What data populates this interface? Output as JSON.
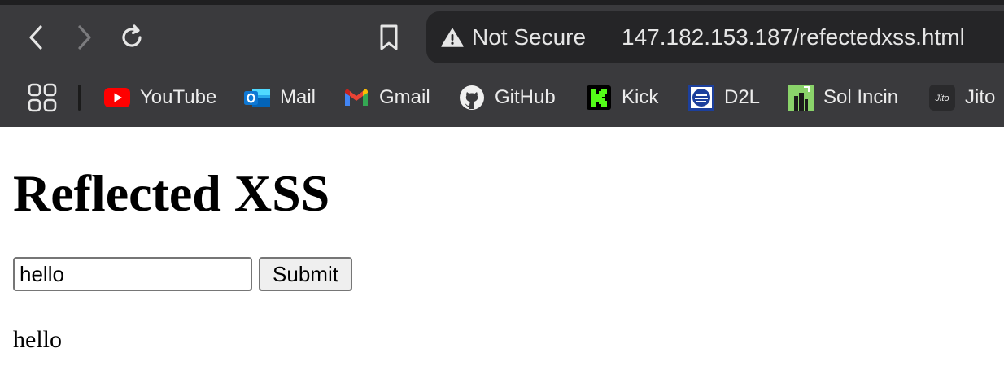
{
  "browser": {
    "address": {
      "security_label": "Not Secure",
      "url": "147.182.153.187/refectedxss.html"
    },
    "bookmarks": [
      {
        "label": "YouTube",
        "icon": "youtube-icon"
      },
      {
        "label": "Mail",
        "icon": "outlook-mail-icon"
      },
      {
        "label": "Gmail",
        "icon": "gmail-icon"
      },
      {
        "label": "GitHub",
        "icon": "github-icon"
      },
      {
        "label": "Kick",
        "icon": "kick-icon"
      },
      {
        "label": "D2L",
        "icon": "d2l-icon"
      },
      {
        "label": "Sol Incin",
        "icon": "sol-incin-icon"
      },
      {
        "label": "Jito",
        "icon": "jito-icon",
        "icon_text": "Jito"
      }
    ]
  },
  "page": {
    "title": "Reflected XSS",
    "input_value": "hello",
    "submit_label": "Submit",
    "output": "hello"
  }
}
